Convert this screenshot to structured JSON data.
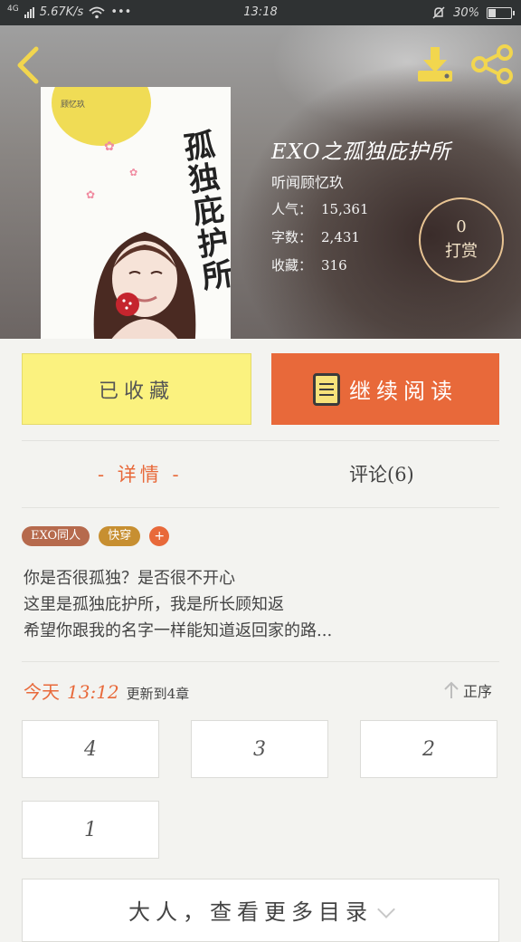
{
  "status_bar": {
    "network": "4G",
    "speed": "5.67K/s",
    "dots": "•••",
    "time": "13:18",
    "battery": "30%"
  },
  "book": {
    "title": "EXO之孤独庇护所",
    "author": "听闻顾忆玖",
    "popularity_label": "人气：",
    "popularity_value": "15,361",
    "word_count_label": "字数：",
    "word_count_value": "2,431",
    "favorites_label": "收藏：",
    "favorites_value": "316",
    "cover_title": "孤独庇护所",
    "cover_author": "顾忆玖"
  },
  "reward": {
    "count": "0",
    "label": "打赏"
  },
  "actions": {
    "collected_label": "已收藏",
    "read_label": "继续阅读"
  },
  "tabs": {
    "details": "- 详情 -",
    "comments": "评论(6)"
  },
  "tags": [
    "EXO同人",
    "快穿"
  ],
  "tag_add": "+",
  "description": [
    "你是否很孤独？是否很不开心",
    "这里是孤独庇护所，我是所长顾知返",
    "希望你跟我的名字一样能知道返回家的路..."
  ],
  "update": {
    "day": "今天",
    "time": "13:12",
    "note": "更新到4章"
  },
  "sort_label": "正序",
  "chapters": [
    "4",
    "3",
    "2",
    "1"
  ],
  "more_label": "大人，查看更多目录",
  "colors": {
    "accent": "#e8693a",
    "collected_bg": "#fbf27f",
    "icon_yellow": "#f7e27a"
  }
}
